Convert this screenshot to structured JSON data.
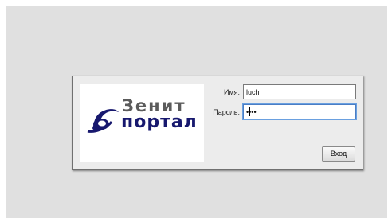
{
  "logo": {
    "line1": "Зенит",
    "line2": "портал",
    "icon": "headset-swoosh-icon",
    "colors": {
      "swoosh": "#17186e",
      "line1": "#5b5b5b",
      "line2": "#17186e"
    }
  },
  "form": {
    "username_label": "Имя:",
    "username_value": "luch",
    "password_label": "Пароль:",
    "password_value": "••••",
    "submit_label": "Вход"
  },
  "colors": {
    "background": "#e0e0e0",
    "dialog": "#ececec",
    "focus_border": "#4a7dc4"
  }
}
